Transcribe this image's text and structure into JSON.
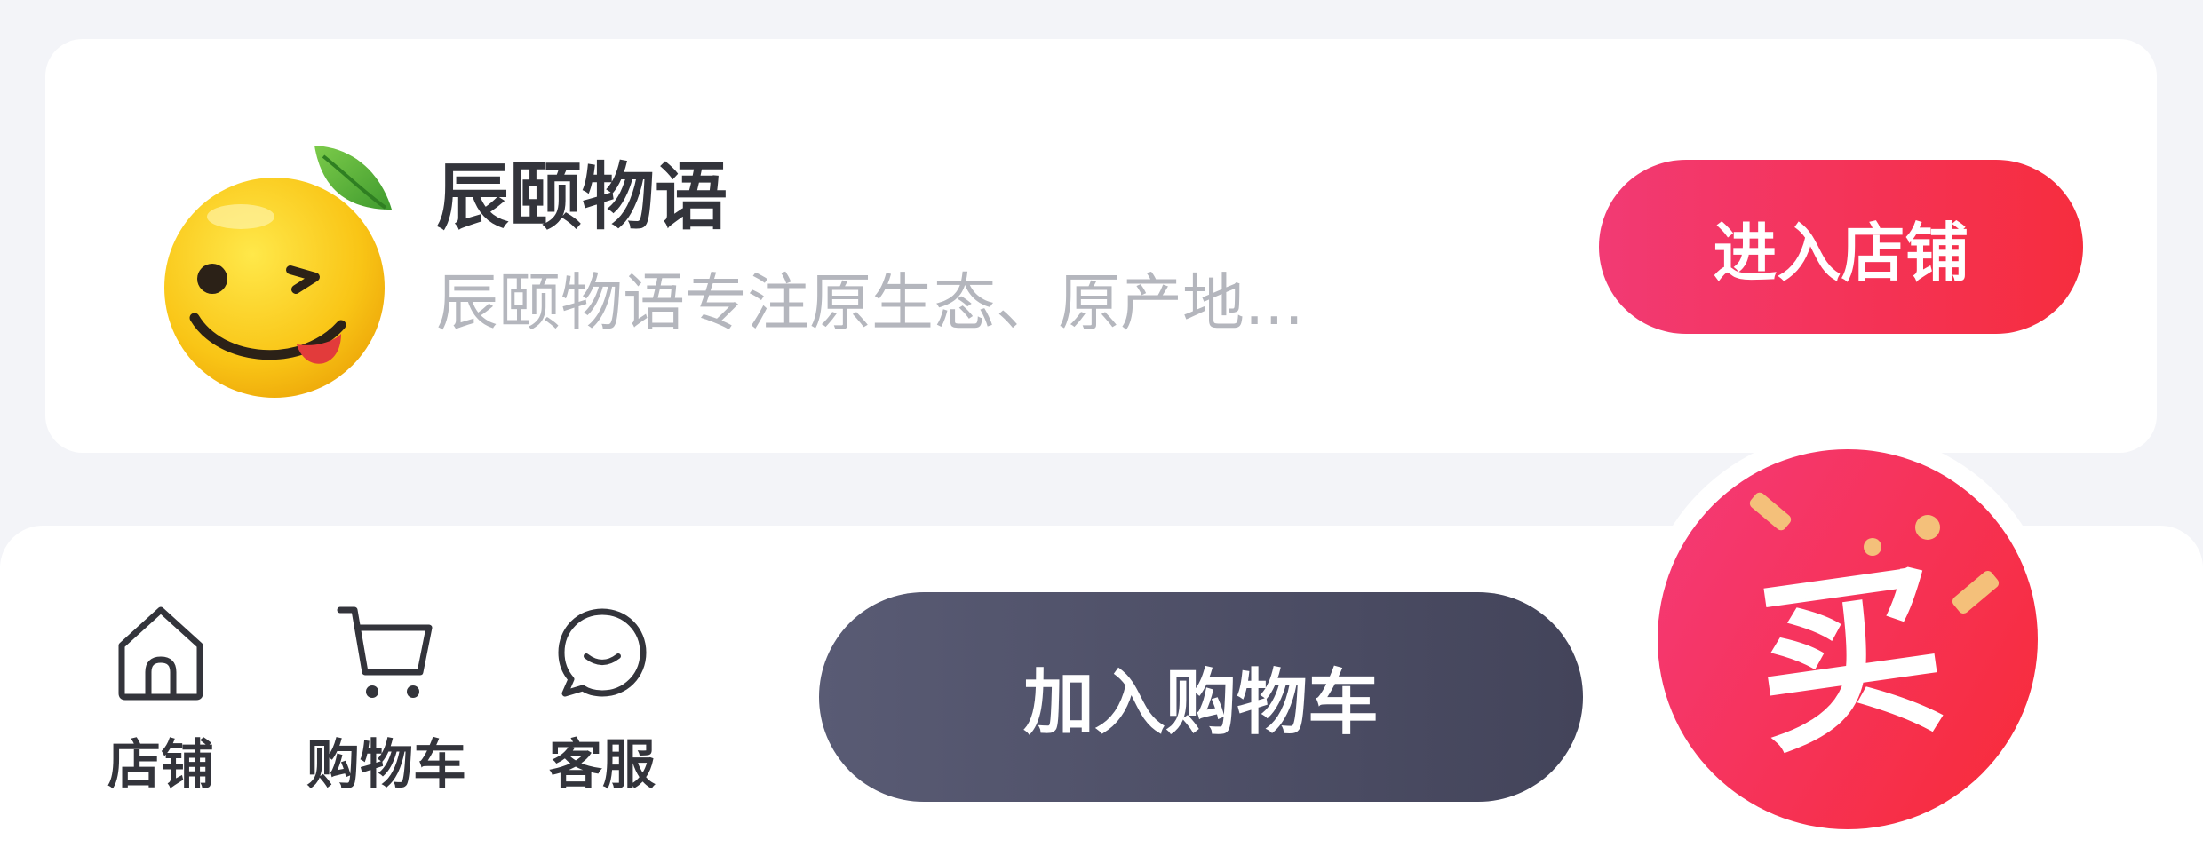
{
  "store": {
    "name": "辰颐物语",
    "description": "辰颐物语专注原生态、原产地...",
    "enter_button": "进入店铺"
  },
  "bottom_bar": {
    "nav_items": [
      {
        "label": "店铺",
        "icon": "store-home-icon"
      },
      {
        "label": "购物车",
        "icon": "cart-icon"
      },
      {
        "label": "客服",
        "icon": "chat-bubble-icon"
      }
    ],
    "add_to_cart_label": "加入购物车",
    "buy_label": "买"
  },
  "colors": {
    "accent_red": "#f62d3e",
    "accent_pink": "#f23a74",
    "dark_button": "#4d4e66",
    "page_background": "#f3f4f8",
    "text_primary": "#33343b",
    "text_secondary": "#b4b6bd"
  }
}
